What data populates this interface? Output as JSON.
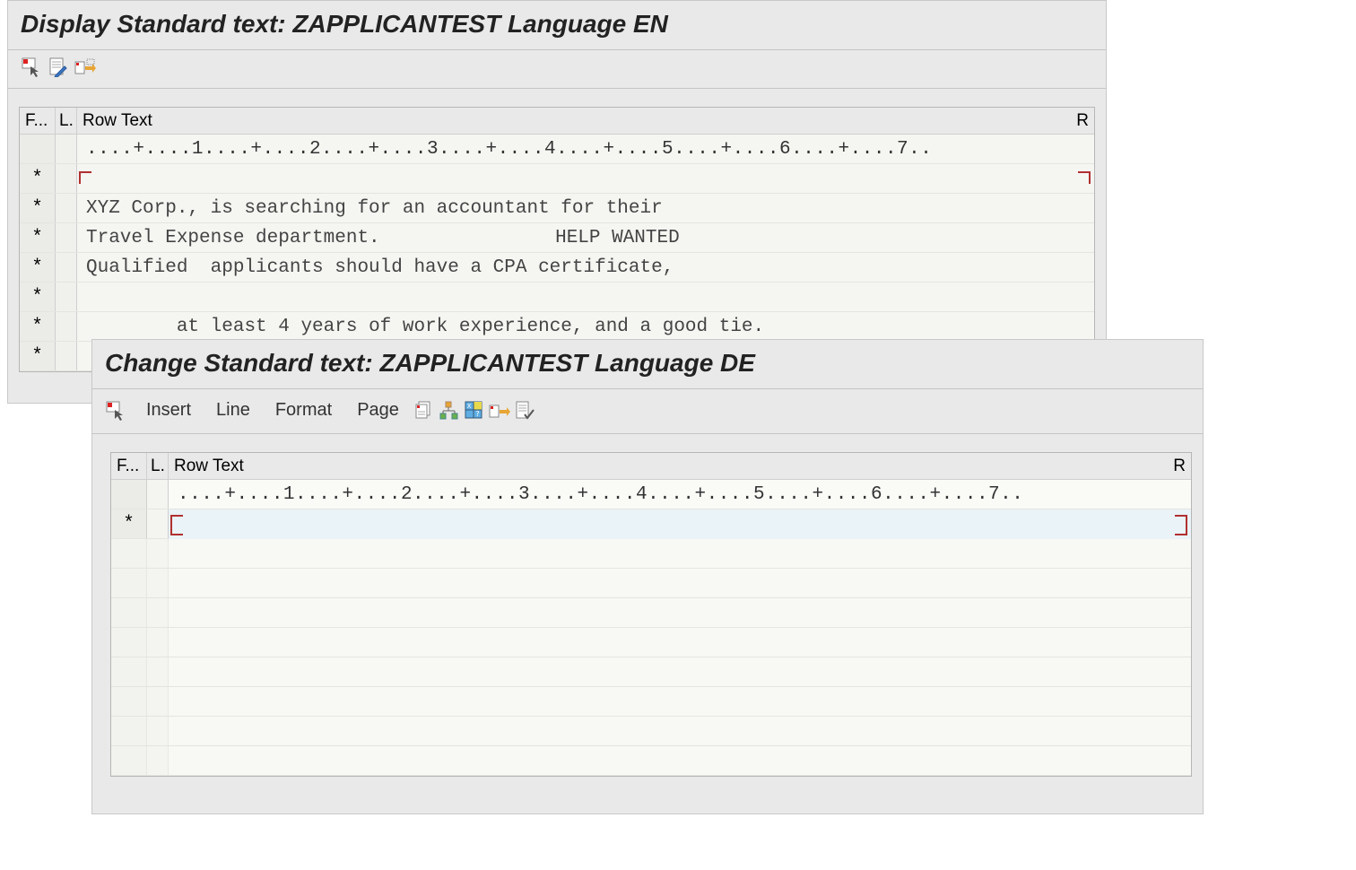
{
  "panel1": {
    "title": "Display Standard text: ZAPPLICANTEST Language EN",
    "header": {
      "f": "F...",
      "l": "L.",
      "row": "Row Text",
      "r": "R"
    },
    "ruler": "....+....1....+....2....+....3....+....4....+....5....+....6....+....7..",
    "rows": [
      {
        "f": "*",
        "text": "HELP WANTED",
        "centered": true
      },
      {
        "f": "*",
        "text": "XYZ Corp., is searching for an accountant for their"
      },
      {
        "f": "*",
        "text": "Travel Expense department."
      },
      {
        "f": "*",
        "text": "Qualified  applicants should have a CPA certificate,"
      },
      {
        "f": "*",
        "text": "at least 4 years of work experience, and a good tie."
      },
      {
        "f": "*",
        "text": ""
      },
      {
        "f": "*",
        "text": ""
      }
    ]
  },
  "panel2": {
    "title": "Change Standard text: ZAPPLICANTEST Language DE",
    "menu": [
      "Insert",
      "Line",
      "Format",
      "Page"
    ],
    "header": {
      "f": "F...",
      "l": "L.",
      "row": "Row Text",
      "r": "R"
    },
    "ruler": "....+....1....+....2....+....3....+....4....+....5....+....6....+....7..",
    "rows": [
      {
        "f": "*",
        "text": "",
        "editing": true
      }
    ],
    "empty_rows": 8
  }
}
